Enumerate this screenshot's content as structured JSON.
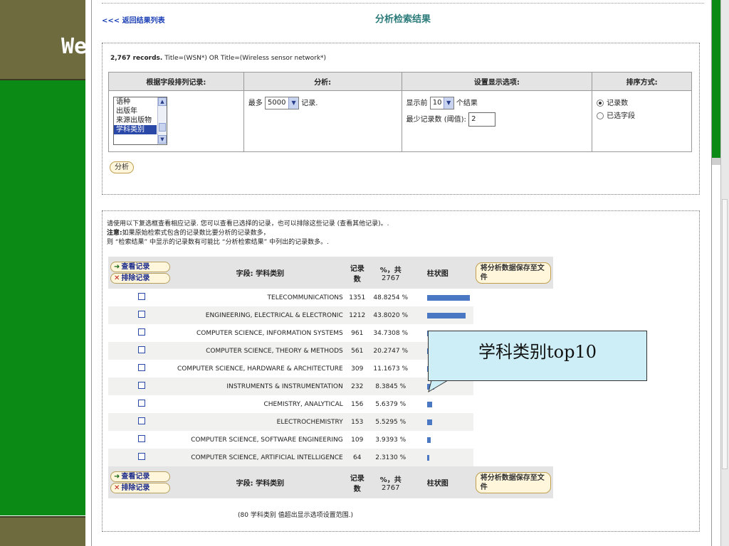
{
  "slide": {
    "word": "We"
  },
  "page": {
    "back_link": "<<< 返回结果列表",
    "title": "分析检索结果"
  },
  "query": {
    "count": "2,767 records.",
    "text": "Title=(WSN*) OR Title=(Wireless sensor network*)"
  },
  "options": {
    "headers": [
      "根据字段排列记录:",
      "分析:",
      "设置显示选项:",
      "排序方式:"
    ],
    "field_list": [
      "语种",
      "出版年",
      "来源出版物",
      "学科类别"
    ],
    "field_selected": "学科类别",
    "analyze_prefix": "最多",
    "analyze_value": "5000",
    "analyze_suffix": "记录.",
    "show_prefix": "显示前",
    "show_value": "10",
    "show_suffix": "个结果",
    "min_label": "最少记录数 (阈值):",
    "min_value": "2",
    "sort_options": [
      "记录数",
      "已选字段"
    ],
    "sort_selected": "记录数",
    "analyze_button": "分析"
  },
  "notes": {
    "line1": "请使用以下复选框查看相应记录. 您可以查看已选择的记录，也可以排除这些记录 (查看其他记录)。.",
    "line2_bold": "注意:",
    "line2": "如果原始检索式包含的记录数比要分析的记录数多，",
    "line3": "则 “检索结果” 中显示的记录数有可能比 “分析检索结果” 中列出的记录数多。."
  },
  "results": {
    "view_button": "查看记录",
    "exclude_button": "排除记录",
    "field_header": "字段: 学科类别",
    "count_header": "记录数",
    "pct_header_line1": "%，共",
    "pct_header_line2": "2767",
    "bar_header": "柱状图",
    "save_button": "将分析数据保存至文件",
    "footer": "(80 学科类别 值超出显示选项设置范围.)",
    "rows": [
      {
        "field": "TELECOMMUNICATIONS",
        "count": "1351",
        "pct": "48.8254 %",
        "fraction": 0.488
      },
      {
        "field": "ENGINEERING, ELECTRICAL & ELECTRONIC",
        "count": "1212",
        "pct": "43.8020 %",
        "fraction": 0.438
      },
      {
        "field": "COMPUTER SCIENCE, INFORMATION SYSTEMS",
        "count": "961",
        "pct": "34.7308 %",
        "fraction": 0.347
      },
      {
        "field": "COMPUTER SCIENCE, THEORY & METHODS",
        "count": "561",
        "pct": "20.2747 %",
        "fraction": 0.203
      },
      {
        "field": "COMPUTER SCIENCE, HARDWARE & ARCHITECTURE",
        "count": "309",
        "pct": "11.1673 %",
        "fraction": 0.112
      },
      {
        "field": "INSTRUMENTS & INSTRUMENTATION",
        "count": "232",
        "pct": "8.3845 %",
        "fraction": 0.084
      },
      {
        "field": "CHEMISTRY, ANALYTICAL",
        "count": "156",
        "pct": "5.6379 %",
        "fraction": 0.056
      },
      {
        "field": "ELECTROCHEMISTRY",
        "count": "153",
        "pct": "5.5295 %",
        "fraction": 0.055
      },
      {
        "field": "COMPUTER SCIENCE, SOFTWARE ENGINEERING",
        "count": "109",
        "pct": "3.9393 %",
        "fraction": 0.039
      },
      {
        "field": "COMPUTER SCIENCE, ARTIFICIAL INTELLIGENCE",
        "count": "64",
        "pct": "2.3130 %",
        "fraction": 0.023
      }
    ]
  },
  "callout": {
    "text": "学科类别top10"
  },
  "colors": {
    "bar": "#4a78c2",
    "slide_green": "#0b8a16",
    "title": "#2a7a7a"
  }
}
